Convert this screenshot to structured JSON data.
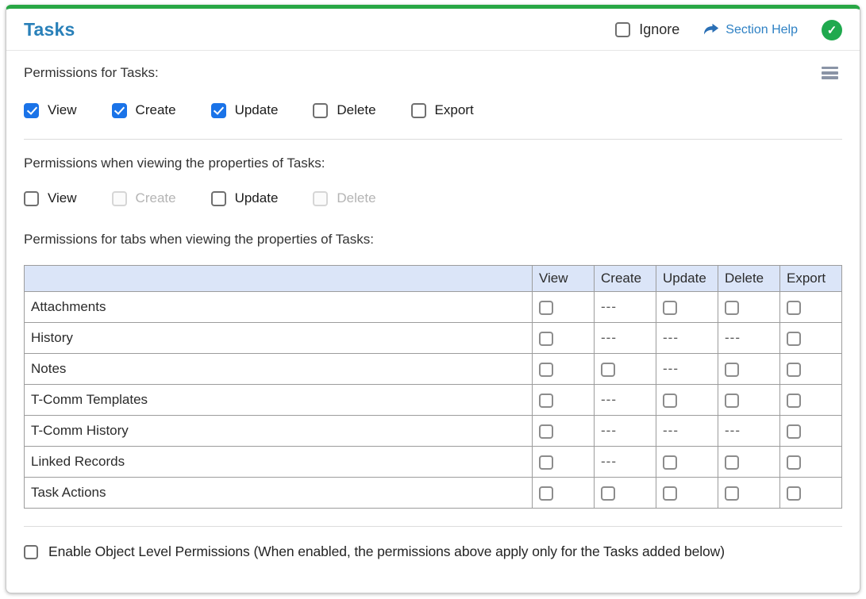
{
  "header": {
    "title": "Tasks",
    "ignore_label": "Ignore",
    "section_help_label": "Section Help",
    "status_icon": "check-circle"
  },
  "colors": {
    "accent_green": "#28a745",
    "title_blue": "#2980b9",
    "link_blue": "#2e81c4",
    "checkbox_blue": "#1a73e8",
    "table_header_bg": "#dbe5f8",
    "status_green": "#1fa94e"
  },
  "icons": {
    "menu": "hamburger-menu-icon",
    "help_arrow": "forward-arrow-icon",
    "status": "check-circle-icon"
  },
  "sections": [
    {
      "label": "Permissions for Tasks:",
      "checkboxes": [
        {
          "label": "View",
          "checked": true,
          "disabled": false
        },
        {
          "label": "Create",
          "checked": true,
          "disabled": false
        },
        {
          "label": "Update",
          "checked": true,
          "disabled": false
        },
        {
          "label": "Delete",
          "checked": false,
          "disabled": false
        },
        {
          "label": "Export",
          "checked": false,
          "disabled": false
        }
      ]
    },
    {
      "label": "Permissions when viewing the properties of Tasks:",
      "checkboxes": [
        {
          "label": "View",
          "checked": false,
          "disabled": false
        },
        {
          "label": "Create",
          "checked": false,
          "disabled": true
        },
        {
          "label": "Update",
          "checked": false,
          "disabled": false
        },
        {
          "label": "Delete",
          "checked": false,
          "disabled": true
        }
      ]
    }
  ],
  "table_section": {
    "label": "Permissions for tabs when viewing the properties of Tasks:",
    "columns": [
      "",
      "View",
      "Create",
      "Update",
      "Delete",
      "Export"
    ],
    "na_text": "---",
    "rows": [
      {
        "name": "Attachments",
        "cells": [
          "checkbox",
          "na",
          "checkbox",
          "checkbox",
          "checkbox"
        ]
      },
      {
        "name": "History",
        "cells": [
          "checkbox",
          "na",
          "na",
          "na",
          "checkbox"
        ]
      },
      {
        "name": "Notes",
        "cells": [
          "checkbox",
          "checkbox",
          "na",
          "checkbox",
          "checkbox"
        ]
      },
      {
        "name": "T-Comm Templates",
        "cells": [
          "checkbox",
          "na",
          "checkbox",
          "checkbox",
          "checkbox"
        ]
      },
      {
        "name": "T-Comm History",
        "cells": [
          "checkbox",
          "na",
          "na",
          "na",
          "checkbox"
        ]
      },
      {
        "name": "Linked Records",
        "cells": [
          "checkbox",
          "na",
          "checkbox",
          "checkbox",
          "checkbox"
        ]
      },
      {
        "name": "Task Actions",
        "cells": [
          "checkbox",
          "checkbox",
          "checkbox",
          "checkbox",
          "checkbox"
        ]
      }
    ]
  },
  "footer": {
    "label": "Enable Object Level Permissions (When enabled, the permissions above apply only for the Tasks added below)",
    "checked": false
  }
}
